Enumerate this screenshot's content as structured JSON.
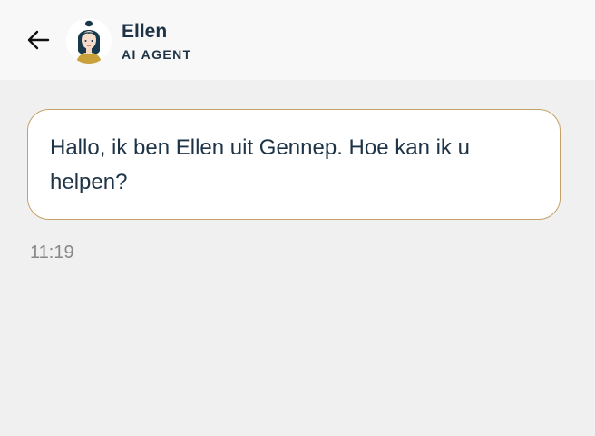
{
  "header": {
    "back_icon": "arrow-left-icon",
    "avatar_icon": "agent-avatar",
    "agent_name": "Ellen",
    "agent_role": "AI AGENT"
  },
  "messages": [
    {
      "text": "Hallo, ik ben Ellen uit Gennep. Hoe kan ik u helpen?",
      "time": "11:19"
    }
  ],
  "colors": {
    "header_bg": "#f8f8f8",
    "page_bg": "#f0f0f0",
    "text_primary": "#1e3446",
    "bubble_border": "#c4a167",
    "timestamp": "#888888"
  }
}
